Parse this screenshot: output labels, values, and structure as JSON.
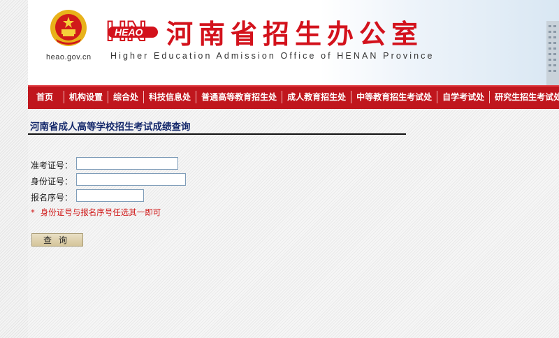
{
  "header": {
    "domain_text": "heao.gov.cn",
    "logo_mark_text": "HEAO",
    "logo_mark_letters": "HN",
    "title_cn": "河南省招生办公室",
    "title_en": "Higher Education Admission Office of HENAN Province"
  },
  "nav": {
    "items": [
      {
        "label": "首页"
      },
      {
        "label": "机构设置"
      },
      {
        "label": "综合处"
      },
      {
        "label": "科技信息处"
      },
      {
        "label": "普通高等教育招生处"
      },
      {
        "label": "成人教育招生处"
      },
      {
        "label": "中等教育招生考试处"
      },
      {
        "label": "自学考试处"
      },
      {
        "label": "研究生招生考试处"
      }
    ]
  },
  "page": {
    "heading": "河南省成人高等学校招生考试成绩查询"
  },
  "form": {
    "exam_id_label": "准考证号：",
    "id_card_label": "身份证号：",
    "reg_no_label": "报名序号：",
    "exam_id_value": "",
    "id_card_value": "",
    "reg_no_value": "",
    "note_star": "*",
    "note_text": "身份证号与报名序号任选其一即可",
    "query_label": "查询"
  },
  "colors": {
    "nav_bg": "#c0161d",
    "title_red": "#d3121c",
    "heading_blue": "#14286b",
    "note_red": "#d01818"
  }
}
